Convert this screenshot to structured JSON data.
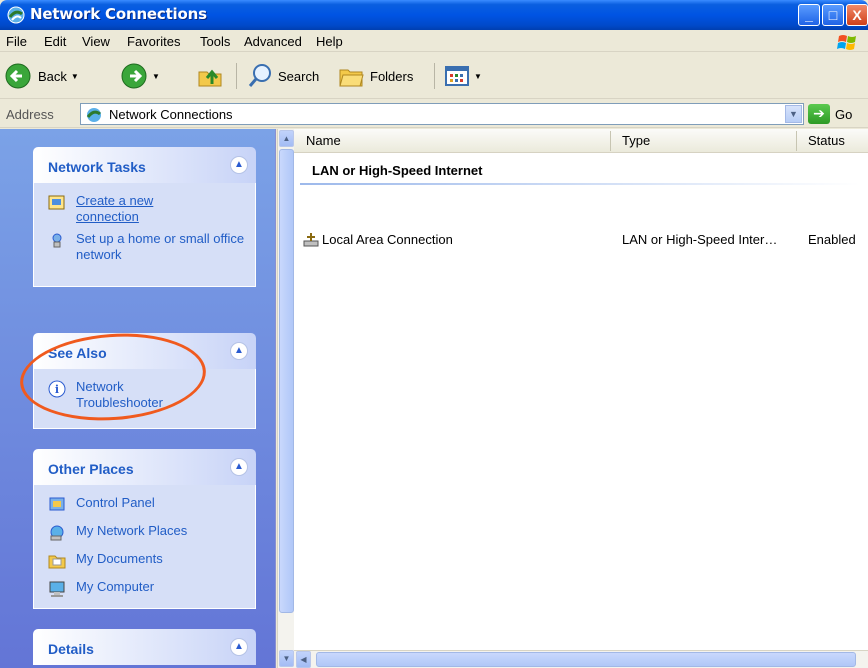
{
  "window": {
    "title": "Network Connections",
    "min_glyph": "_",
    "max_glyph": "□",
    "close_glyph": "X"
  },
  "menu": {
    "items": [
      "File",
      "Edit",
      "View",
      "Favorites",
      "Tools",
      "Advanced",
      "Help"
    ]
  },
  "toolbar": {
    "back_label": "Back",
    "search_label": "Search",
    "folders_label": "Folders"
  },
  "address": {
    "label": "Address",
    "value": "Network Connections",
    "go_label": "Go"
  },
  "task_pane": {
    "network_tasks": {
      "title": "Network Tasks",
      "items": [
        "Create a new connection",
        "Set up a home or small office network"
      ]
    },
    "see_also": {
      "title": "See Also",
      "items": [
        "Network Troubleshooter"
      ]
    },
    "other_places": {
      "title": "Other Places",
      "items": [
        "Control Panel",
        "My Network Places",
        "My Documents",
        "My Computer"
      ]
    },
    "details": {
      "title": "Details"
    }
  },
  "list": {
    "columns": [
      "Name",
      "Type",
      "Status"
    ],
    "group": "LAN or High-Speed Internet",
    "rows": [
      {
        "name": "Local Area Connection",
        "type": "LAN or High-Speed Inter…",
        "status": "Enabled"
      }
    ]
  },
  "colors": {
    "titlebar": "#0054e3",
    "task_pane_bg": "#6375d6",
    "link": "#215dc6",
    "highlight_ring": "#f05a1e"
  },
  "icons": [
    "network-connections-icon",
    "windows-flag-icon",
    "back-arrow-icon",
    "forward-arrow-icon",
    "up-folder-icon",
    "search-icon",
    "folders-icon",
    "views-icon",
    "new-connection-icon",
    "home-network-icon",
    "info-icon",
    "control-panel-icon",
    "network-places-icon",
    "documents-icon",
    "computer-icon",
    "lan-connection-icon"
  ]
}
